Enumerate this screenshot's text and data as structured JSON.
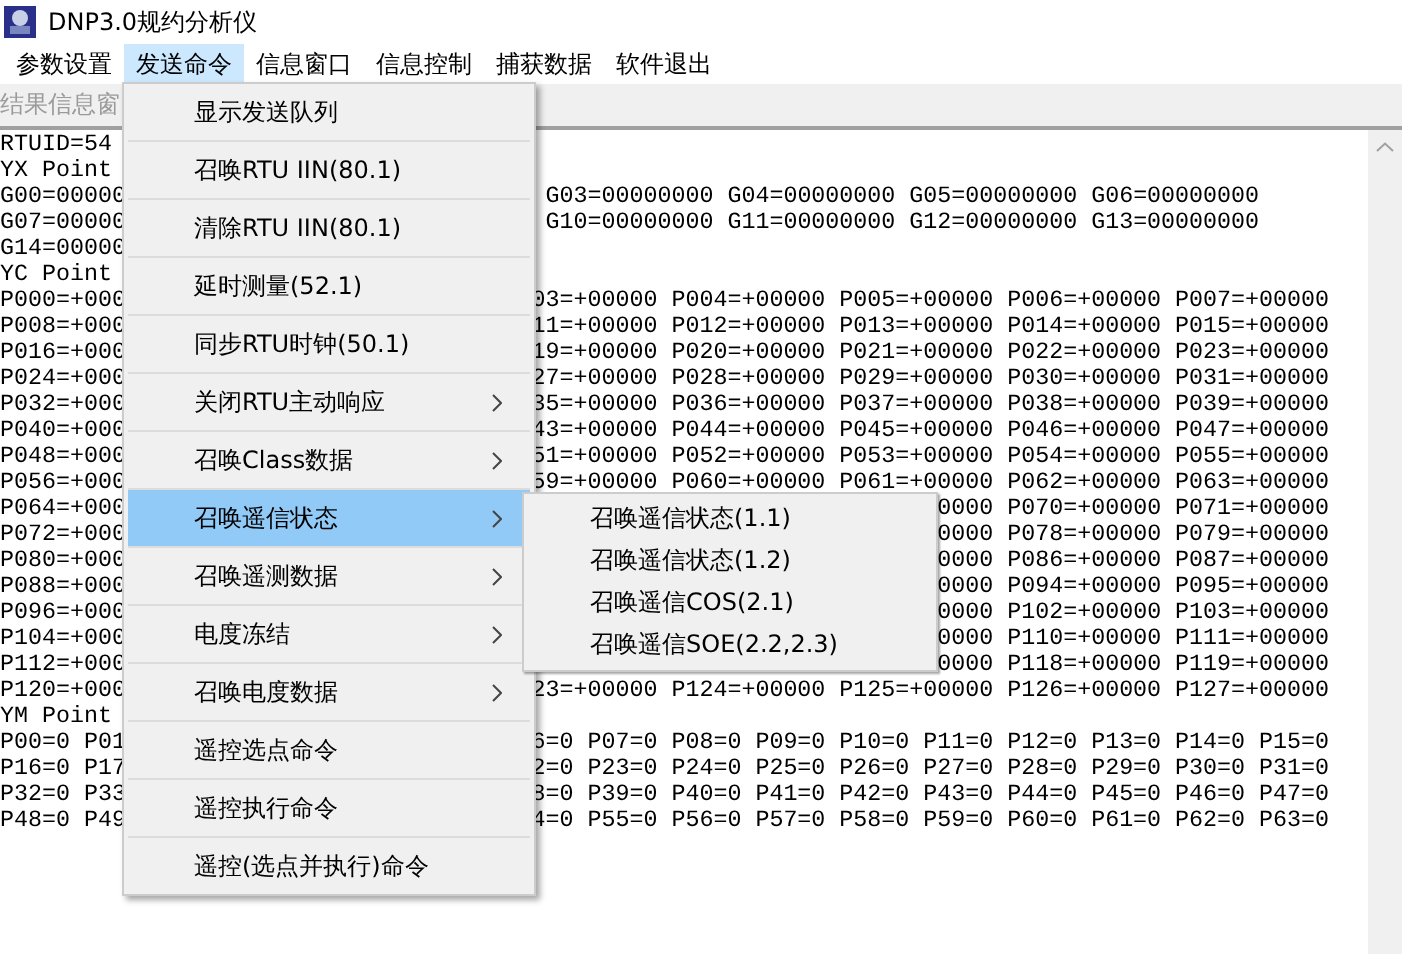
{
  "window": {
    "title": "DNP3.0规约分析仪"
  },
  "menubar": [
    {
      "label": "参数设置",
      "selected": false
    },
    {
      "label": "发送命令",
      "selected": true
    },
    {
      "label": "信息窗口",
      "selected": false
    },
    {
      "label": "信息控制",
      "selected": false
    },
    {
      "label": "捕获数据",
      "selected": false
    },
    {
      "label": "软件退出",
      "selected": false
    }
  ],
  "pane_tab": "结果信息窗",
  "console": {
    "first_line": "RTUID=54",
    "sections": [
      {
        "kind": "status",
        "header": "YX Point",
        "rows": [
          {
            "left": "G00=00000",
            "right": "G03=00000000 G04=00000000 G05=00000000 G06=00000000"
          },
          {
            "left": "G07=00000",
            "right": "G10=00000000 G11=00000000 G12=00000000 G13=00000000"
          },
          {
            "left": "G14=00000"
          }
        ]
      },
      {
        "kind": "analog",
        "header": "YC Point",
        "rows": [
          {
            "left": "P000=+000",
            "right": "03=+00000 P004=+00000 P005=+00000 P006=+00000 P007=+00000"
          },
          {
            "left": "P008=+000",
            "right": "11=+00000 P012=+00000 P013=+00000 P014=+00000 P015=+00000"
          },
          {
            "left": "P016=+000",
            "right": "19=+00000 P020=+00000 P021=+00000 P022=+00000 P023=+00000"
          },
          {
            "left": "P024=+000",
            "right": "27=+00000 P028=+00000 P029=+00000 P030=+00000 P031=+00000"
          },
          {
            "left": "P032=+000",
            "right": "35=+00000 P036=+00000 P037=+00000 P038=+00000 P039=+00000"
          },
          {
            "left": "P040=+000",
            "right": "43=+00000 P044=+00000 P045=+00000 P046=+00000 P047=+00000"
          },
          {
            "left": "P048=+000",
            "right": "51=+00000 P052=+00000 P053=+00000 P054=+00000 P055=+00000"
          },
          {
            "left": "P056=+000",
            "right": "59=+00000 P060=+00000 P061=+00000 P062=+00000 P063=+00000"
          },
          {
            "left": "P064=+000",
            "right": "0000 P070=+00000 P071=+00000"
          },
          {
            "left": "P072=+000",
            "right": "0000 P078=+00000 P079=+00000"
          },
          {
            "left": "P080=+000",
            "right": "0000 P086=+00000 P087=+00000"
          },
          {
            "left": "P088=+000",
            "right": "0000 P094=+00000 P095=+00000"
          },
          {
            "left": "P096=+000",
            "right": "0000 P102=+00000 P103=+00000"
          },
          {
            "left": "P104=+000",
            "right": "0000 P110=+00000 P111=+00000"
          },
          {
            "left": "P112=+000",
            "right": "0000 P118=+00000 P119=+00000"
          },
          {
            "left": "P120=+000",
            "right": "23=+00000 P124=+00000 P125=+00000 P126=+00000 P127=+00000"
          }
        ]
      },
      {
        "kind": "counter",
        "header": "YM Point",
        "rows": [
          {
            "left": "P00=0 P01",
            "right": "6=0 P07=0 P08=0 P09=0 P10=0 P11=0 P12=0 P13=0 P14=0 P15=0"
          },
          {
            "left": "P16=0 P17",
            "right": "2=0 P23=0 P24=0 P25=0 P26=0 P27=0 P28=0 P29=0 P30=0 P31=0"
          },
          {
            "left": "P32=0 P33",
            "right": "8=0 P39=0 P40=0 P41=0 P42=0 P43=0 P44=0 P45=0 P46=0 P47=0"
          },
          {
            "left": "P48=0 P49",
            "right": "4=0 P55=0 P56=0 P57=0 P58=0 P59=0 P60=0 P61=0 P62=0 P63=0"
          }
        ]
      }
    ]
  },
  "menu": {
    "items": [
      {
        "label": "显示发送队列",
        "submenu": false,
        "selected": false
      },
      {
        "label": "召唤RTU IIN(80.1)",
        "submenu": false,
        "selected": false
      },
      {
        "label": "清除RTU IIN(80.1)",
        "submenu": false,
        "selected": false
      },
      {
        "label": "延时测量(52.1)",
        "submenu": false,
        "selected": false
      },
      {
        "label": "同步RTU时钟(50.1)",
        "submenu": false,
        "selected": false
      },
      {
        "label": "关闭RTU主动响应",
        "submenu": true,
        "selected": false
      },
      {
        "label": "召唤Class数据",
        "submenu": true,
        "selected": false
      },
      {
        "label": "召唤遥信状态",
        "submenu": true,
        "selected": true
      },
      {
        "label": "召唤遥测数据",
        "submenu": true,
        "selected": false
      },
      {
        "label": "电度冻结",
        "submenu": true,
        "selected": false
      },
      {
        "label": "召唤电度数据",
        "submenu": true,
        "selected": false
      },
      {
        "label": "遥控选点命令",
        "submenu": false,
        "selected": false
      },
      {
        "label": "遥控执行命令",
        "submenu": false,
        "selected": false
      },
      {
        "label": "遥控(选点并执行)命令",
        "submenu": false,
        "selected": false
      }
    ]
  },
  "submenu": {
    "items": [
      {
        "label": "召唤遥信状态(1.1)",
        "selected": false
      },
      {
        "label": "召唤遥信状态(1.2)",
        "selected": false
      },
      {
        "label": "召唤遥信COS(2.1)",
        "selected": false
      },
      {
        "label": "召唤遥信SOE(2.2,2.3)",
        "selected": false
      }
    ]
  }
}
